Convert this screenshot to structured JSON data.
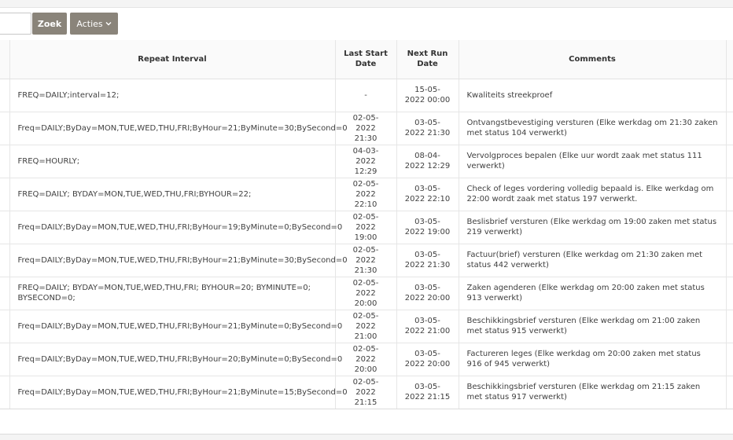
{
  "toolbar": {
    "search_placeholder": "",
    "search_value": "",
    "search_button_label": "Zoek",
    "actions_button_label": "Acties"
  },
  "table": {
    "columns": {
      "repeat_interval": "Repeat Interval",
      "last_start_date": "Last Start Date",
      "next_run_date": "Next Run Date",
      "comments": "Comments"
    },
    "rows": [
      {
        "repeat_interval": "FREQ=DAILY;interval=12;",
        "last_start": "-",
        "next_run": "15-05-2022 00:00",
        "comments": "Kwaliteits streekproef"
      },
      {
        "repeat_interval": "Freq=DAILY;ByDay=MON,TUE,WED,THU,FRI;ByHour=21;ByMinute=30;BySecond=0",
        "last_start": "02-05-2022 21:30",
        "next_run": "03-05-2022 21:30",
        "comments": "Ontvangstbevestiging versturen (Elke werkdag om 21:30 zaken met status 104 verwerkt)"
      },
      {
        "repeat_interval": "FREQ=HOURLY;",
        "last_start": "04-03-2022 12:29",
        "next_run": "08-04-2022 12:29",
        "comments": "Vervolgproces bepalen (Elke uur wordt zaak met status 111 verwerkt)"
      },
      {
        "repeat_interval": "FREQ=DAILY; BYDAY=MON,TUE,WED,THU,FRI;BYHOUR=22;",
        "last_start": "02-05-2022 22:10",
        "next_run": "03-05-2022 22:10",
        "comments": "Check of leges vordering volledig bepaald is. Elke werkdag om 22:00 wordt zaak met status 197 verwerkt."
      },
      {
        "repeat_interval": "Freq=DAILY;ByDay=MON,TUE,WED,THU,FRI;ByHour=19;ByMinute=0;BySecond=0",
        "last_start": "02-05-2022 19:00",
        "next_run": "03-05-2022 19:00",
        "comments": "Beslisbrief versturen (Elke werkdag om 19:00 zaken met status 219 verwerkt)"
      },
      {
        "repeat_interval": "Freq=DAILY;ByDay=MON,TUE,WED,THU,FRI;ByHour=21;ByMinute=30;BySecond=0",
        "last_start": "02-05-2022 21:30",
        "next_run": "03-05-2022 21:30",
        "comments": "Factuur(brief) versturen (Elke werkdag om 21:30 zaken met status 442 verwerkt)"
      },
      {
        "repeat_interval": "FREQ=DAILY; BYDAY=MON,TUE,WED,THU,FRI; BYHOUR=20; BYMINUTE=0; BYSECOND=0;",
        "last_start": "02-05-2022 20:00",
        "next_run": "03-05-2022 20:00",
        "comments": "Zaken agenderen (Elke werkdag om 20:00 zaken met status 913 verwerkt)"
      },
      {
        "repeat_interval": "Freq=DAILY;ByDay=MON,TUE,WED,THU,FRI;ByHour=21;ByMinute=0;BySecond=0",
        "last_start": "02-05-2022 21:00",
        "next_run": "03-05-2022 21:00",
        "comments": "Beschikkingsbrief versturen (Elke werkdag om 21:00 zaken met status 915 verwerkt)"
      },
      {
        "repeat_interval": "Freq=DAILY;ByDay=MON,TUE,WED,THU,FRI;ByHour=20;ByMinute=0;BySecond=0",
        "last_start": "02-05-2022 20:00",
        "next_run": "03-05-2022 20:00",
        "comments": "Factureren leges (Elke werkdag om 20:00 zaken met status 916 of 945 verwerkt)"
      },
      {
        "repeat_interval": "Freq=DAILY;ByDay=MON,TUE,WED,THU,FRI;ByHour=21;ByMinute=15;BySecond=0",
        "last_start": "02-05-2022 21:15",
        "next_run": "03-05-2022 21:15",
        "comments": "Beschikkingsbrief versturen (Elke werkdag om 21:15 zaken met status 917 verwerkt)"
      }
    ]
  },
  "icons": {
    "acties_dropdown": "chevron-down-icon"
  },
  "colors": {
    "button_bg": "#8a847a",
    "header_bg": "#fafafa"
  }
}
